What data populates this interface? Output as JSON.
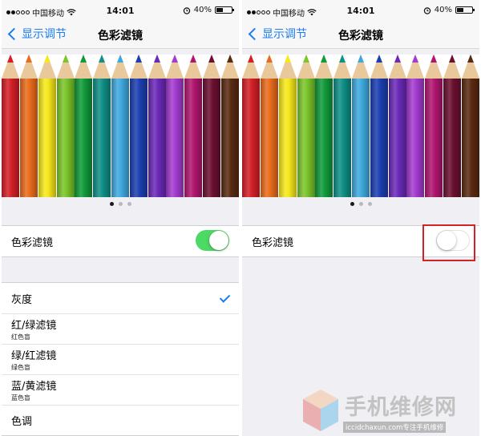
{
  "left_screen": {
    "status": {
      "carrier": "中国移动",
      "time": "14:01",
      "battery": "40%"
    },
    "nav": {
      "back_label": "显示调节",
      "title": "色彩滤镜"
    },
    "toggle_row": {
      "label": "色彩滤镜",
      "state": "on"
    },
    "filters": [
      {
        "label": "灰度",
        "sublabel": "",
        "selected": true
      },
      {
        "label": "红/绿滤镜",
        "sublabel": "红色盲",
        "selected": false
      },
      {
        "label": "绿/红滤镜",
        "sublabel": "绿色盲",
        "selected": false
      },
      {
        "label": "蓝/黄滤镜",
        "sublabel": "蓝色盲",
        "selected": false
      },
      {
        "label": "色调",
        "sublabel": "",
        "selected": false
      }
    ]
  },
  "right_screen": {
    "status": {
      "carrier": "中国移动",
      "time": "14:01",
      "battery": "40%"
    },
    "nav": {
      "back_label": "显示调节",
      "title": "色彩滤镜"
    },
    "toggle_row": {
      "label": "色彩滤镜",
      "state": "off"
    }
  },
  "pencil_colors": [
    "#d32027",
    "#ea6b1c",
    "#f6e81b",
    "#7cc52a",
    "#119a3a",
    "#0f8f86",
    "#3fa9de",
    "#1c3fb0",
    "#6a2ab8",
    "#a33bd0",
    "#b0166f",
    "#6b1030",
    "#5a2a12"
  ],
  "page_indicator": {
    "count": 3,
    "active": 0
  },
  "accent_colors": {
    "ios_blue": "#1b7cf3",
    "toggle_green": "#4cd964",
    "highlight_red": "#d2232a"
  },
  "watermark": {
    "title": "手机维修网",
    "subtitle": "iccidchaxun.com专注手机维修"
  }
}
